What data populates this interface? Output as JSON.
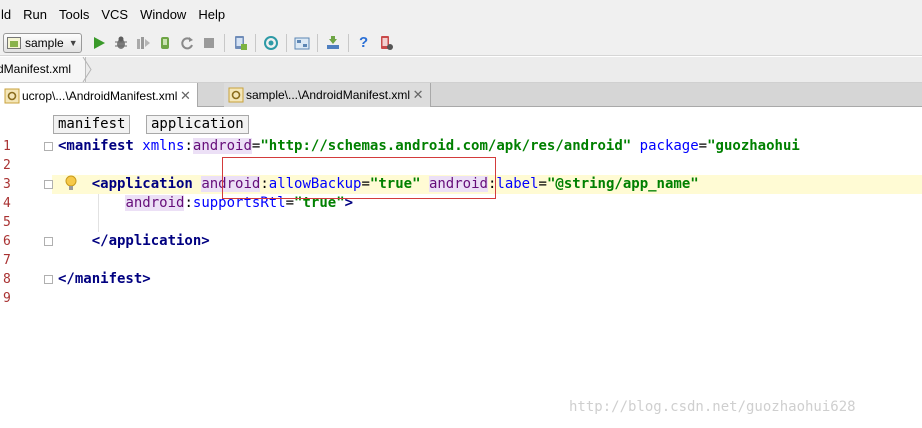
{
  "menubar": {
    "items": [
      "ld",
      "Run",
      "Tools",
      "VCS",
      "Window",
      "Help"
    ]
  },
  "toolbar": {
    "run_config": "sample",
    "icons": [
      "run-icon",
      "debug-icon",
      "coverage-icon",
      "attach-debugger-icon",
      "rerun-icon",
      "stop-icon",
      "android-device-icon",
      "sync-gradle-icon",
      "project-structure-icon",
      "sdk-manager-icon",
      "help-icon",
      "android-monitor-icon"
    ]
  },
  "navbar": {
    "breadcrumb": "dManifest.xml"
  },
  "tabs": [
    {
      "label": "ucrop\\...\\AndroidManifest.xml",
      "active": true
    },
    {
      "label": "sample\\...\\AndroidManifest.xml",
      "active": false
    }
  ],
  "xml_breadcrumbs": [
    "manifest",
    "application"
  ],
  "code": {
    "line_numbers": [
      "1",
      "2",
      "3",
      "4",
      "5",
      "6",
      "7",
      "8",
      "9"
    ],
    "l1": {
      "open": "<manifest",
      "attr1": "xmlns",
      "colon1": ":",
      "ns1": "android",
      "eq1": "=",
      "val1": "\"http://schemas.android.com/apk/res/android\"",
      "attr2": "package",
      "eq2": "=",
      "val2": "\"guozhaohui"
    },
    "l3": {
      "open": "<application",
      "ns1": "android",
      "colon1": ":",
      "attr1": "allowBackup",
      "eq1": "=",
      "val1": "\"true\"",
      "ns2": "android",
      "colon2": ":",
      "attr2": "label",
      "eq2": "=",
      "val2": "\"@string/app_name\""
    },
    "l4": {
      "ns1": "android",
      "colon1": ":",
      "attr1": "supportsRtl",
      "eq1": "=",
      "val1": "\"true\"",
      "close": ">"
    },
    "l6": {
      "close": "</application>"
    },
    "l8": {
      "close": "</manifest>"
    }
  },
  "watermark": "http://blog.csdn.net/guozhaohui628",
  "colors": {
    "tag": "#000080",
    "attribute": "#0000ff",
    "namespace": "#660e7a",
    "value": "#008000",
    "line_number": "#a93232",
    "highlight_box": "#d33b3b"
  }
}
